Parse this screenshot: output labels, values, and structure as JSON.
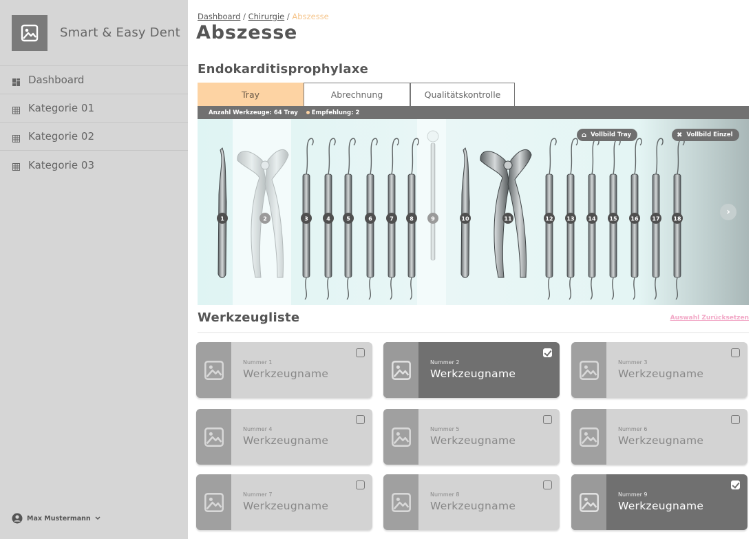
{
  "app": {
    "brand_name": "Smart & Easy Dent",
    "logo_icon": "image-icon"
  },
  "sidebar": {
    "items": [
      {
        "label": "Dashboard",
        "icon": "dashboard-icon"
      },
      {
        "label": "Kategorie 01",
        "icon": "grid-icon"
      },
      {
        "label": "Kategorie 02",
        "icon": "grid-icon"
      },
      {
        "label": "Kategorie 03",
        "icon": "grid-icon"
      }
    ],
    "user": {
      "name": "Max Mustermann",
      "icon": "user-circle-icon"
    }
  },
  "breadcrumb": {
    "items": [
      "Dashboard",
      "Chirurgie"
    ],
    "separator": "/",
    "current": "Abszesse"
  },
  "page": {
    "title": "Abszesse",
    "section_title": "Endokarditisprophylaxe"
  },
  "tabs": [
    {
      "label": "Tray",
      "active": true
    },
    {
      "label": "Abrechnung",
      "active": false
    },
    {
      "label": "Qualitätskontrolle",
      "active": false
    }
  ],
  "infobar": {
    "count_text": "Anzahl Werkzeuge: 64 Tray",
    "recommendation_text": "Empfehlung: 2"
  },
  "tray": {
    "fullscreen_tray_label": "Vollbild Tray",
    "fullscreen_single_label": "Vollbild Einzel",
    "next_icon": "chevron-right-icon",
    "instrument_numbers": [
      "1",
      "2",
      "3",
      "4",
      "5",
      "6",
      "7",
      "8",
      "9",
      "10",
      "11",
      "12",
      "13",
      "14",
      "15",
      "16",
      "17",
      "18"
    ],
    "highlighted_numbers": [
      "2",
      "9"
    ]
  },
  "list": {
    "title": "Werkzeugliste",
    "reset_label": "Auswahl Zurücksetzen",
    "cards": [
      {
        "number": "Nummer 1",
        "name": "Werkzeugname",
        "selected": false
      },
      {
        "number": "Nummer 2",
        "name": "Werkzeugname",
        "selected": true
      },
      {
        "number": "Nummer 3",
        "name": "Werkzeugname",
        "selected": false
      },
      {
        "number": "Nummer 4",
        "name": "Werkzeugname",
        "selected": false
      },
      {
        "number": "Nummer 5",
        "name": "Werkzeugname",
        "selected": false
      },
      {
        "number": "Nummer 6",
        "name": "Werkzeugname",
        "selected": false
      },
      {
        "number": "Nummer 7",
        "name": "Werkzeugname",
        "selected": false
      },
      {
        "number": "Nummer 8",
        "name": "Werkzeugname",
        "selected": false
      },
      {
        "number": "Nummer 9",
        "name": "Werkzeugname",
        "selected": true
      }
    ]
  },
  "colors": {
    "accent": "#fdd3a3",
    "sidebar": "#d6d6d6",
    "dark": "#707070",
    "link_pink": "#f2a7c6"
  }
}
